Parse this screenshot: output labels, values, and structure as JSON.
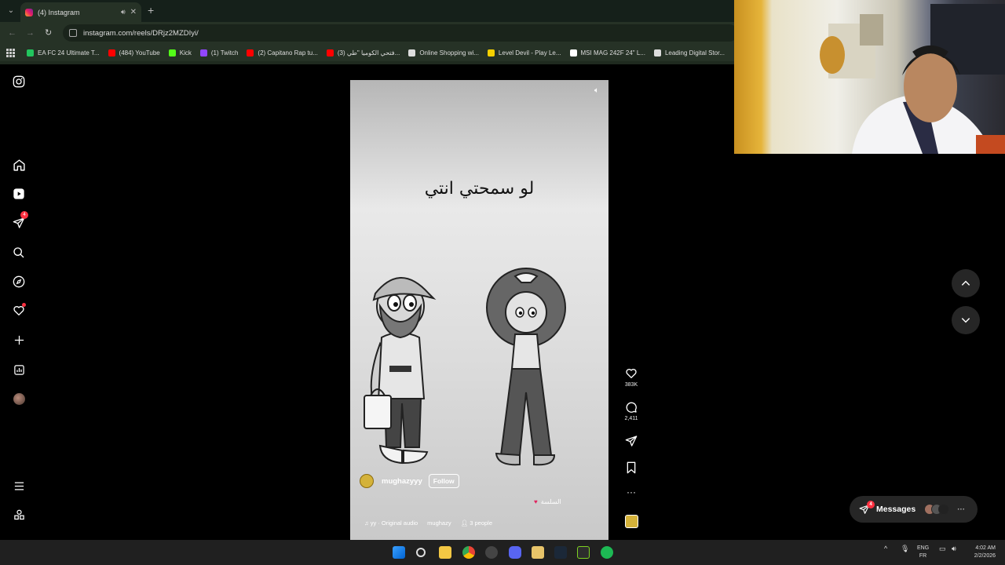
{
  "browser": {
    "tab_title": "(4) Instagram",
    "url": "instagram.com/reels/DRjz2MZDIyi/",
    "bookmarks": [
      {
        "label": "EA FC 24 Ultimate T...",
        "color": "#22c55e"
      },
      {
        "label": "(484) YouTube",
        "color": "#ff0000"
      },
      {
        "label": "Kick",
        "color": "#53fc18"
      },
      {
        "label": "(1) Twitch",
        "color": "#9146ff"
      },
      {
        "label": "(2) Capitano Rap tu...",
        "color": "#ff0000"
      },
      {
        "label": "(3) فتحي الكوميا \"طي...",
        "color": "#ff0000"
      },
      {
        "label": "Online Shopping wi...",
        "color": "#dddddd"
      },
      {
        "label": "Level Devil - Play Le...",
        "color": "#f5d000"
      },
      {
        "label": "MSI MAG 242F 24\" L...",
        "color": "#ffffff"
      },
      {
        "label": "Leading Digital Stor...",
        "color": "#dddddd"
      }
    ]
  },
  "sidebar": {
    "notifications_count": "4",
    "items": [
      "instagram-logo",
      "home",
      "reels",
      "direct",
      "search",
      "explore",
      "notifications",
      "create",
      "dashboard",
      "profile",
      "more",
      "also-from-meta"
    ]
  },
  "reel": {
    "caption": "لو سمحتي انتي",
    "username": "mughazyyy",
    "follow_label": "Follow",
    "tagline": "السلسة",
    "audio": "yy · Original audio",
    "audio_user": "mughazy",
    "people": "3 people",
    "likes": "383K",
    "comments": "2,411"
  },
  "messages": {
    "label": "Messages",
    "badge": "4"
  },
  "taskbar": {
    "lang": "ENG",
    "layout": "FR",
    "time": "4:02 AM",
    "date": "2/2/2026"
  },
  "colors": {
    "badge": "#ff3040",
    "panel": "#262626",
    "accent": "#0095f6"
  }
}
